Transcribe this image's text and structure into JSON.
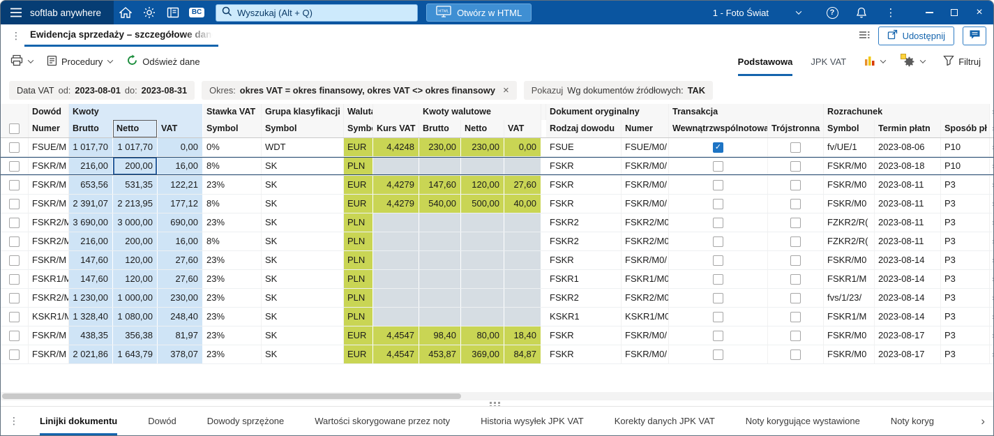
{
  "colors": {
    "topbar": "#0a55a0",
    "topbar_dark": "#063d74",
    "accent": "#1464ad",
    "amount_column": "#cfe4f6",
    "currency_column": "#c9d554",
    "empty_currency_column": "#d6dde3",
    "selected_row_border": "#24486f",
    "checkbox_checked": "#1d74c4",
    "refresh_icon_green": "#1e8e3e"
  },
  "glyphs": {
    "check": "✓",
    "close": "×",
    "more": "›",
    "kebab": "⋮",
    "bc": "BC",
    "help": "?",
    "html": "HTML"
  },
  "topbar": {
    "logo": "softlab anywhere",
    "search_placeholder": "Wyszukaj (Alt + Q)",
    "open_html": "Otwórz w HTML",
    "company": "1 - Foto Świat"
  },
  "tabrow": {
    "title": "Ewidencja sprzedaży – szczegółowe dane",
    "share": "Udostępnij"
  },
  "toolbar": {
    "procedures": "Procedury",
    "refresh": "Odśwież dane",
    "views": [
      {
        "label": "Podstawowa",
        "active": true
      },
      {
        "label": "JPK VAT",
        "active": false
      }
    ],
    "filter": "Filtruj"
  },
  "filters": {
    "date": {
      "label": "Data VAT",
      "from_label": "od:",
      "from": "2023-08-01",
      "to_label": "do:",
      "to": "2023-08-31"
    },
    "period": {
      "label": "Okres:",
      "value": "okres VAT = okres finansowy, okres VAT <> okres finansowy"
    },
    "show": {
      "label": "Pokazuj",
      "key": "Wg dokumentów źródłowych:",
      "value": "TAK"
    }
  },
  "table": {
    "selection": {
      "row_index": 1,
      "column_key": "netto"
    },
    "groups": [
      {
        "label": "",
        "span": 1
      },
      {
        "label": "Dowód",
        "span": 1
      },
      {
        "label": "Kwoty",
        "span": 3,
        "color": "blue"
      },
      {
        "label": "Stawka VAT",
        "span": 1
      },
      {
        "label": "Grupa klasyfikacji",
        "span": 1
      },
      {
        "label": "Waluta",
        "span": 1
      },
      {
        "label": "Kwoty walutowe",
        "span": 4,
        "center": true
      },
      {
        "label": "",
        "span": 1
      },
      {
        "label": "Dokument oryginalny",
        "span": 2
      },
      {
        "label": "Transakcja",
        "span": 2
      },
      {
        "label": "Rozrachunek",
        "span": 3
      },
      {
        "label": "",
        "span": 1,
        "edge": true
      }
    ],
    "columns": [
      {
        "key": "chk",
        "label": "",
        "type": "check"
      },
      {
        "key": "dowod",
        "label": "Numer",
        "align": "left"
      },
      {
        "key": "brutto",
        "label": "Brutto",
        "align": "right",
        "color": "blue"
      },
      {
        "key": "netto",
        "label": "Netto",
        "align": "right",
        "color": "blue",
        "sorted": true
      },
      {
        "key": "vat",
        "label": "VAT",
        "align": "right",
        "color": "blue"
      },
      {
        "key": "stawka",
        "label": "Symbol",
        "align": "left"
      },
      {
        "key": "grupa",
        "label": "Symbol",
        "align": "left"
      },
      {
        "key": "waluta",
        "label": "Symbol",
        "align": "left",
        "color": "green"
      },
      {
        "key": "kurs",
        "label": "Kurs VAT",
        "align": "right",
        "color": "dyn"
      },
      {
        "key": "wbrutto",
        "label": "Brutto",
        "align": "right",
        "color": "dyn"
      },
      {
        "key": "wnetto",
        "label": "Netto",
        "align": "right",
        "color": "dyn"
      },
      {
        "key": "wvat",
        "label": "VAT",
        "align": "right",
        "color": "dyn"
      },
      {
        "key": "sp",
        "label": "",
        "type": "spacer"
      },
      {
        "key": "rodzaj",
        "label": "Rodzaj dowodu",
        "align": "left"
      },
      {
        "key": "dnumer",
        "label": "Numer",
        "align": "left"
      },
      {
        "key": "wewn",
        "label": "Wewnątrzwspólnotowa",
        "type": "check"
      },
      {
        "key": "troj",
        "label": "Trójstronna",
        "type": "check"
      },
      {
        "key": "symbol",
        "label": "Symbol",
        "align": "left"
      },
      {
        "key": "termin",
        "label": "Termin płatn",
        "align": "left"
      },
      {
        "key": "sposob",
        "label": "Sposób pł",
        "align": "left"
      },
      {
        "key": "edge",
        "label": "",
        "type": "edge"
      }
    ],
    "rows": [
      {
        "dowod": "FSUE/M",
        "brutto": "1 017,70",
        "netto": "1 017,70",
        "vat": "0,00",
        "stawka": "0%",
        "grupa": "WDT",
        "waluta": "EUR",
        "kurs": "4,4248",
        "wbrutto": "230,00",
        "wnetto": "230,00",
        "wvat": "0,00",
        "rodzaj": "FSUE",
        "dnumer": "FSUE/M0/",
        "wewn": true,
        "troj": false,
        "symbol": "fv/UE/1",
        "termin": "2023-08-06",
        "sposob": "P10"
      },
      {
        "dowod": "FSKR/M",
        "brutto": "216,00",
        "netto": "200,00",
        "vat": "16,00",
        "stawka": "8%",
        "grupa": "SK",
        "waluta": "PLN",
        "kurs": "",
        "wbrutto": "",
        "wnetto": "",
        "wvat": "",
        "rodzaj": "FSKR",
        "dnumer": "FSKR/M0/",
        "wewn": false,
        "troj": false,
        "symbol": "FSKR/M0",
        "termin": "2023-08-18",
        "sposob": "P10"
      },
      {
        "dowod": "FSKR/M",
        "brutto": "653,56",
        "netto": "531,35",
        "vat": "122,21",
        "stawka": "23%",
        "grupa": "SK",
        "waluta": "EUR",
        "kurs": "4,4279",
        "wbrutto": "147,60",
        "wnetto": "120,00",
        "wvat": "27,60",
        "rodzaj": "FSKR",
        "dnumer": "FSKR/M0/",
        "wewn": false,
        "troj": false,
        "symbol": "FSKR/M0",
        "termin": "2023-08-11",
        "sposob": "P3"
      },
      {
        "dowod": "FSKR/M",
        "brutto": "2 391,07",
        "netto": "2 213,95",
        "vat": "177,12",
        "stawka": "8%",
        "grupa": "SK",
        "waluta": "EUR",
        "kurs": "4,4279",
        "wbrutto": "540,00",
        "wnetto": "500,00",
        "wvat": "40,00",
        "rodzaj": "FSKR",
        "dnumer": "FSKR/M0/",
        "wewn": false,
        "troj": false,
        "symbol": "FSKR/M0",
        "termin": "2023-08-11",
        "sposob": "P3"
      },
      {
        "dowod": "FSKR2/M",
        "brutto": "3 690,00",
        "netto": "3 000,00",
        "vat": "690,00",
        "stawka": "23%",
        "grupa": "SK",
        "waluta": "PLN",
        "kurs": "",
        "wbrutto": "",
        "wnetto": "",
        "wvat": "",
        "rodzaj": "FSKR2",
        "dnumer": "FSKR2/M0",
        "wewn": false,
        "troj": false,
        "symbol": "FZKR2/R(",
        "termin": "2023-08-11",
        "sposob": "P3"
      },
      {
        "dowod": "FSKR2/M",
        "brutto": "216,00",
        "netto": "200,00",
        "vat": "16,00",
        "stawka": "8%",
        "grupa": "SK",
        "waluta": "PLN",
        "kurs": "",
        "wbrutto": "",
        "wnetto": "",
        "wvat": "",
        "rodzaj": "FSKR2",
        "dnumer": "FSKR2/M0",
        "wewn": false,
        "troj": false,
        "symbol": "FZKR2/R(",
        "termin": "2023-08-11",
        "sposob": "P3"
      },
      {
        "dowod": "FSKR/M",
        "brutto": "147,60",
        "netto": "120,00",
        "vat": "27,60",
        "stawka": "23%",
        "grupa": "SK",
        "waluta": "PLN",
        "kurs": "",
        "wbrutto": "",
        "wnetto": "",
        "wvat": "",
        "rodzaj": "FSKR",
        "dnumer": "FSKR/M0/",
        "wewn": false,
        "troj": false,
        "symbol": "FSKR/M0",
        "termin": "2023-08-14",
        "sposob": "P3"
      },
      {
        "dowod": "FSKR1/M",
        "brutto": "147,60",
        "netto": "120,00",
        "vat": "27,60",
        "stawka": "23%",
        "grupa": "SK",
        "waluta": "PLN",
        "kurs": "",
        "wbrutto": "",
        "wnetto": "",
        "wvat": "",
        "rodzaj": "FSKR1",
        "dnumer": "FSKR1/M0",
        "wewn": false,
        "troj": false,
        "symbol": "FSKR1/M",
        "termin": "2023-08-14",
        "sposob": "P3"
      },
      {
        "dowod": "FSKR2/M",
        "brutto": "1 230,00",
        "netto": "1 000,00",
        "vat": "230,00",
        "stawka": "23%",
        "grupa": "SK",
        "waluta": "PLN",
        "kurs": "",
        "wbrutto": "",
        "wnetto": "",
        "wvat": "",
        "rodzaj": "FSKR2",
        "dnumer": "FSKR2/M0",
        "wewn": false,
        "troj": false,
        "symbol": "fvs/1/23/",
        "termin": "2023-08-14",
        "sposob": "P3"
      },
      {
        "dowod": "KSKR1/M",
        "brutto": "1 328,40",
        "netto": "1 080,00",
        "vat": "248,40",
        "stawka": "23%",
        "grupa": "SK",
        "waluta": "PLN",
        "kurs": "",
        "wbrutto": "",
        "wnetto": "",
        "wvat": "",
        "rodzaj": "KSKR1",
        "dnumer": "KSKR1/M0",
        "wewn": false,
        "troj": false,
        "symbol": "FSKR1/M",
        "termin": "2023-08-14",
        "sposob": "P3"
      },
      {
        "dowod": "FSKR/M",
        "brutto": "438,35",
        "netto": "356,38",
        "vat": "81,97",
        "stawka": "23%",
        "grupa": "SK",
        "waluta": "EUR",
        "kurs": "4,4547",
        "wbrutto": "98,40",
        "wnetto": "80,00",
        "wvat": "18,40",
        "rodzaj": "FSKR",
        "dnumer": "FSKR/M0/",
        "wewn": false,
        "troj": false,
        "symbol": "FSKR/M0",
        "termin": "2023-08-17",
        "sposob": "P3"
      },
      {
        "dowod": "FSKR/M",
        "brutto": "2 021,86",
        "netto": "1 643,79",
        "vat": "378,07",
        "stawka": "23%",
        "grupa": "SK",
        "waluta": "EUR",
        "kurs": "4,4547",
        "wbrutto": "453,87",
        "wnetto": "369,00",
        "wvat": "84,87",
        "rodzaj": "FSKR",
        "dnumer": "FSKR/M0/",
        "wewn": false,
        "troj": false,
        "symbol": "FSKR/M0",
        "termin": "2023-08-17",
        "sposob": "P3"
      }
    ]
  },
  "bottombar": {
    "tabs": [
      {
        "label": "Linijki dokumentu",
        "active": true
      },
      {
        "label": "Dowód"
      },
      {
        "label": "Dowody sprzężone"
      },
      {
        "label": "Wartości skorygowane przez noty"
      },
      {
        "label": "Historia wysyłek JPK VAT"
      },
      {
        "label": "Korekty danych JPK VAT"
      },
      {
        "label": "Noty korygujące wystawione"
      },
      {
        "label": "Noty koryg"
      }
    ]
  }
}
